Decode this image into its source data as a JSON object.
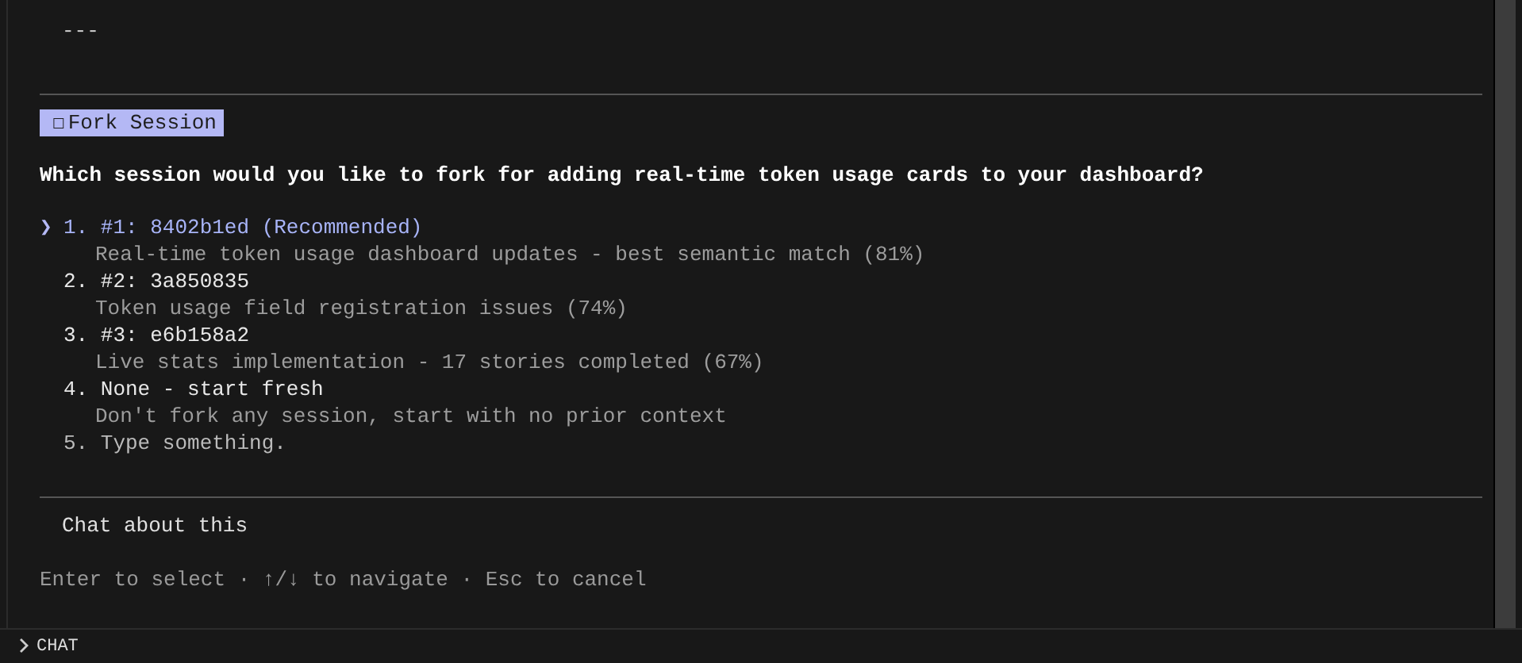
{
  "preamble": "---",
  "dialog": {
    "badge_icon": "☐",
    "badge": "Fork Session",
    "question": "Which session would you like to fork for adding real-time token usage cards to your dashboard?",
    "cursor": "❯",
    "options": [
      {
        "number": "1.",
        "title": "#1: 8402b1ed (Recommended)",
        "description": "Real-time token usage dashboard updates - best semantic match (81%)",
        "selected": true
      },
      {
        "number": "2.",
        "title": "#2: 3a850835",
        "description": "Token usage field registration issues (74%)",
        "selected": false
      },
      {
        "number": "3.",
        "title": "#3: e6b158a2",
        "description": "Live stats implementation - 17 stories completed (67%)",
        "selected": false
      },
      {
        "number": "4.",
        "title": "None - start fresh",
        "description": "Don't fork any session, start with no prior context",
        "selected": false
      },
      {
        "number": "5.",
        "title": "Type something.",
        "selected": false
      }
    ],
    "chat_option": "Chat about this",
    "hint": "Enter to select · ↑/↓ to navigate · Esc to cancel"
  },
  "panel": {
    "title": "CHAT",
    "expanded": false
  }
}
